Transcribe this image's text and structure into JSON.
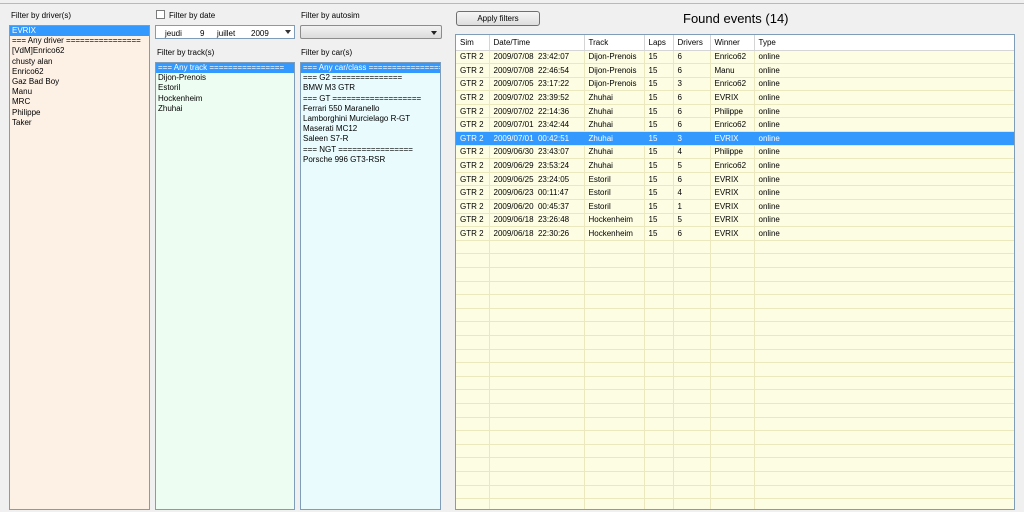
{
  "drivers": {
    "label": "Filter by driver(s)",
    "items": [
      "EVRIX",
      "=== Any driver ================",
      "[VdM]Enrico62",
      "chusty alan",
      "Enrico62",
      "Gaz Bad Boy",
      "Manu",
      "MRC",
      "Philippe",
      "Taker"
    ],
    "selected_index": 0
  },
  "date_filter": {
    "label": "Filter by date",
    "checked": false,
    "weekday": "jeudi",
    "day": "9",
    "month": "juillet",
    "year": "2009"
  },
  "autosim": {
    "label": "Filter by autosim",
    "value": ""
  },
  "tracks": {
    "label": "Filter by track(s)",
    "items": [
      "=== Any track ================",
      "Dijon-Prenois",
      "Estoril",
      "Hockenheim",
      "Zhuhai"
    ],
    "selected_index": 0
  },
  "cars": {
    "label": "Filter by car(s)",
    "items": [
      "=== Any car/class ================",
      "=== G2 ===============",
      "BMW M3 GTR",
      "=== GT ===================",
      "Ferrari 550 Maranello",
      "Lamborghini Murcielago R-GT",
      "Maserati MC12",
      "Saleen S7-R",
      "=== NGT ================",
      "Porsche 996 GT3-RSR"
    ],
    "selected_index": 0
  },
  "apply_button": "Apply filters",
  "found_title": "Found events (14)",
  "events": {
    "columns": [
      "Sim",
      "Date/Time",
      "Track",
      "Laps",
      "Drivers",
      "Winner",
      "Type"
    ],
    "rows": [
      [
        "GTR 2",
        "2009/07/08  23:42:07",
        "Dijon-Prenois",
        "15",
        "6",
        "Enrico62",
        "online"
      ],
      [
        "GTR 2",
        "2009/07/08  22:46:54",
        "Dijon-Prenois",
        "15",
        "6",
        "Manu",
        "online"
      ],
      [
        "GTR 2",
        "2009/07/05  23:17:22",
        "Dijon-Prenois",
        "15",
        "3",
        "Enrico62",
        "online"
      ],
      [
        "GTR 2",
        "2009/07/02  23:39:52",
        "Zhuhai",
        "15",
        "6",
        "EVRIX",
        "online"
      ],
      [
        "GTR 2",
        "2009/07/02  22:14:36",
        "Zhuhai",
        "15",
        "6",
        "Philippe",
        "online"
      ],
      [
        "GTR 2",
        "2009/07/01  23:42:44",
        "Zhuhai",
        "15",
        "6",
        "Enrico62",
        "online"
      ],
      [
        "GTR 2",
        "2009/07/01  00:42:51",
        "Zhuhai",
        "15",
        "3",
        "EVRIX",
        "online"
      ],
      [
        "GTR 2",
        "2009/06/30  23:43:07",
        "Zhuhai",
        "15",
        "4",
        "Philippe",
        "online"
      ],
      [
        "GTR 2",
        "2009/06/29  23:53:24",
        "Zhuhai",
        "15",
        "5",
        "Enrico62",
        "online"
      ],
      [
        "GTR 2",
        "2009/06/25  23:24:05",
        "Estoril",
        "15",
        "6",
        "EVRIX",
        "online"
      ],
      [
        "GTR 2",
        "2009/06/23  00:11:47",
        "Estoril",
        "15",
        "4",
        "EVRIX",
        "online"
      ],
      [
        "GTR 2",
        "2009/06/20  00:45:37",
        "Estoril",
        "15",
        "1",
        "EVRIX",
        "online"
      ],
      [
        "GTR 2",
        "2009/06/18  23:26:48",
        "Hockenheim",
        "15",
        "5",
        "EVRIX",
        "online"
      ],
      [
        "GTR 2",
        "2009/06/18  22:30:26",
        "Hockenheim",
        "15",
        "6",
        "EVRIX",
        "online"
      ]
    ],
    "selected_row": 6
  },
  "colors": {
    "selection": "#3399ff",
    "drivers_bg": "#fdf1e6",
    "tracks_bg": "#edfdf1",
    "cars_bg": "#e9fbfd",
    "grid_bg": "#fdfde3"
  }
}
